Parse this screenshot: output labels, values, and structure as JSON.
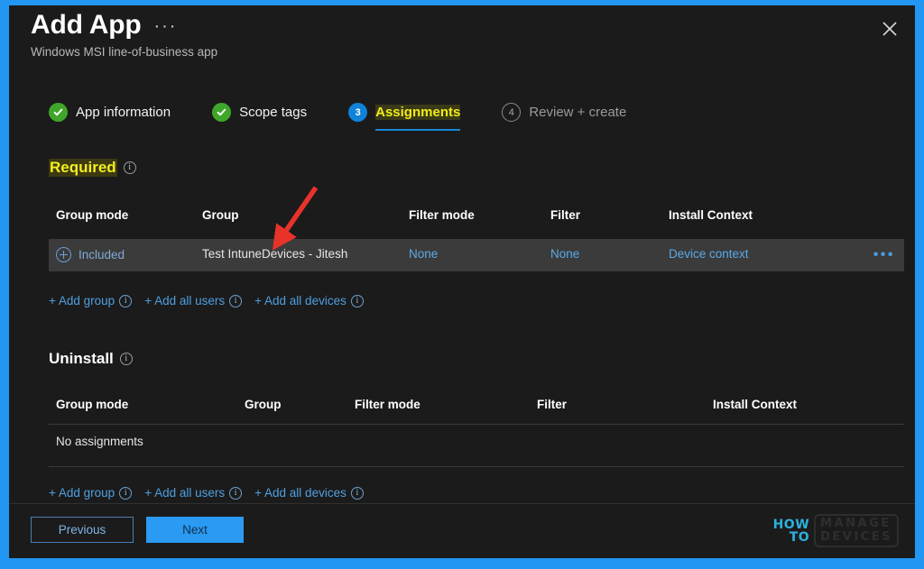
{
  "window": {
    "title": "Add App",
    "subtitle": "Windows MSI line-of-business app",
    "ellipsis": "···",
    "close_icon": "close-icon",
    "accent_color": "#2196f3",
    "background_color": "#1b1b1b"
  },
  "wizard": {
    "steps": [
      {
        "label": "App information",
        "state": "done",
        "marker": "✓"
      },
      {
        "label": "Scope tags",
        "state": "done",
        "marker": "✓"
      },
      {
        "label": "Assignments",
        "state": "current",
        "marker": "3"
      },
      {
        "label": "Review + create",
        "state": "future",
        "marker": "4"
      }
    ],
    "current_color": "#f2ec1a",
    "done_color": "#3fa62a",
    "current_badge_color": "#0f83d9"
  },
  "required_section": {
    "title": "Required",
    "info_icon": "info-icon",
    "columns": [
      "Group mode",
      "Group",
      "Filter mode",
      "Filter",
      "Install Context"
    ],
    "rows": [
      {
        "group_mode": "Included",
        "group_mode_icon": "plus-circle-icon",
        "group": "Test IntuneDevices - Jitesh",
        "filter_mode": "None",
        "filter": "None",
        "install_context": "Device context",
        "overflow": "•••"
      }
    ],
    "actions": [
      {
        "label": "+ Add group",
        "info": "ⓘ"
      },
      {
        "label": "+ Add all users",
        "info": "ⓘ"
      },
      {
        "label": "+ Add all devices",
        "info": "ⓘ"
      }
    ]
  },
  "uninstall_section": {
    "title": "Uninstall",
    "info_icon": "info-icon",
    "columns": [
      "Group mode",
      "Group",
      "Filter mode",
      "Filter",
      "Install Context"
    ],
    "empty_message": "No assignments",
    "actions": [
      {
        "label": "+ Add group",
        "info": "ⓘ"
      },
      {
        "label": "+ Add all users",
        "info": "ⓘ"
      },
      {
        "label": "+ Add all devices",
        "info": "ⓘ"
      }
    ]
  },
  "footer": {
    "previous_label": "Previous",
    "next_label": "Next"
  },
  "watermark": {
    "how": "HOW",
    "to": "TO",
    "manage": "MANAGE",
    "devices": "DEVICES"
  },
  "annotation": {
    "arrow_color": "#e8332a",
    "arrow_points_to": "Group cell of required assignment row"
  }
}
